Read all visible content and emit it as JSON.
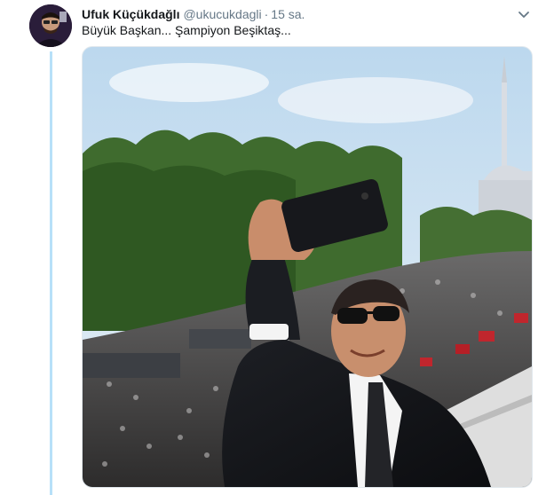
{
  "tweet": {
    "author_name": "Ufuk Küçükdağlı",
    "author_handle": "@ukucukdagli",
    "separator": "·",
    "timestamp": "15 sa.",
    "text": "Büyük Başkan... Şampiyon Beşiktaş..."
  },
  "icons": {
    "caret": "chevron-down-icon",
    "avatar": "avatar"
  },
  "colors": {
    "thread_line": "#b7e0f8",
    "name": "#14171a",
    "meta": "#657786",
    "border": "#e1e8ed"
  }
}
